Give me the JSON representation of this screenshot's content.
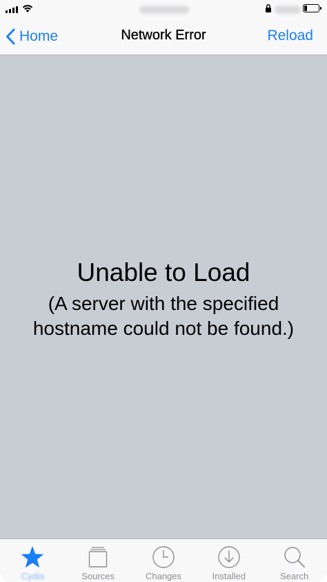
{
  "status_bar": {
    "time_redacted": true,
    "battery_redacted": true
  },
  "nav": {
    "back_label": "Home",
    "title": "Network Error",
    "reload_label": "Reload"
  },
  "error": {
    "title": "Unable to Load",
    "detail_line1": "(A server with the specified",
    "detail_line2": "hostname could not be found.)"
  },
  "tabs": [
    {
      "label": "Cydia",
      "icon": "star-icon",
      "active": true
    },
    {
      "label": "Sources",
      "icon": "sources-icon",
      "active": false
    },
    {
      "label": "Changes",
      "icon": "clock-icon",
      "active": false
    },
    {
      "label": "Installed",
      "icon": "download-icon",
      "active": false
    },
    {
      "label": "Search",
      "icon": "search-icon",
      "active": false
    }
  ],
  "colors": {
    "accent": "#1a7ef5",
    "content_background": "#c8cdd4",
    "bar_background": "#f8f8f9",
    "inactive_tab": "#8e8e93"
  }
}
